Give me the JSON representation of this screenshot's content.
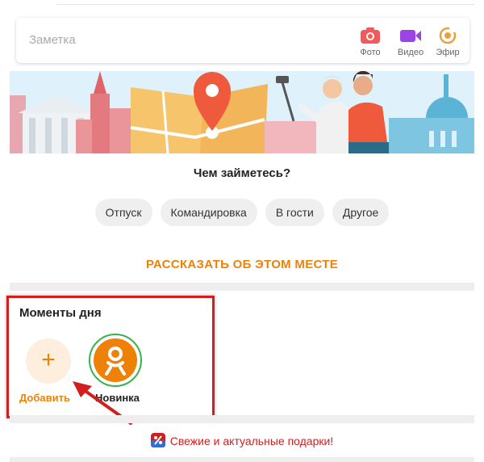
{
  "note": {
    "placeholder": "Заметка",
    "actions": [
      {
        "label": "Фото",
        "icon": "camera-icon",
        "color": "#f05a5a"
      },
      {
        "label": "Видео",
        "icon": "video-camera-icon",
        "color": "#9b45e4"
      },
      {
        "label": "Эфир",
        "icon": "live-broadcast-icon",
        "color": "#e9a23b"
      }
    ]
  },
  "banner": {
    "icon": "travel-illustration",
    "accent": "#f05a3c"
  },
  "activity": {
    "question": "Чем займетесь?",
    "chips": [
      "Отпуск",
      "Командировка",
      "В гости",
      "Другое"
    ],
    "link": "РАССКАЗАТЬ ОБ ЭТОМ МЕСТЕ"
  },
  "moments": {
    "title": "Моменты дня",
    "add_label": "Добавить",
    "add_symbol": "+",
    "ok_label": "Новинка"
  },
  "gifts": {
    "text": "Свежие и актуальные подарки!"
  },
  "colors": {
    "accent": "#ee8208",
    "highlight": "#d11f1f",
    "ring": "#37b24d"
  }
}
